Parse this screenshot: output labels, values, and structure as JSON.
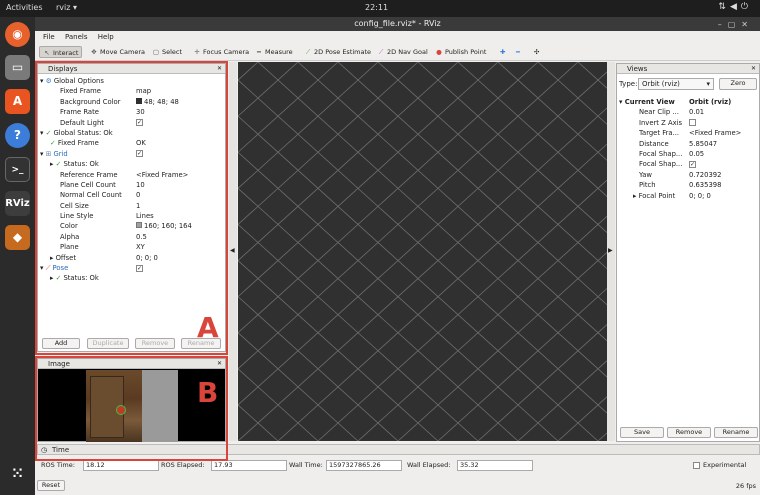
{
  "topbar": {
    "activities": "Activities",
    "app_name": "rviz ▾",
    "clock": "22:11"
  },
  "window": {
    "title": "config_file.rviz* - RViz"
  },
  "menu": [
    "File",
    "Panels",
    "Help"
  ],
  "toolbar": [
    {
      "label": "Interact",
      "icon": "interact-icon",
      "glyph": "↖"
    },
    {
      "label": "Move Camera",
      "icon": "move-camera-icon",
      "glyph": "✥"
    },
    {
      "label": "Select",
      "icon": "select-icon",
      "glyph": "▢"
    },
    {
      "label": "Focus Camera",
      "icon": "focus-icon",
      "glyph": "✛"
    },
    {
      "label": "Measure",
      "icon": "measure-icon",
      "glyph": "━"
    },
    {
      "label": "2D Pose Estimate",
      "icon": "pose-estimate-icon",
      "glyph": "⟋"
    },
    {
      "label": "2D Nav Goal",
      "icon": "nav-goal-icon",
      "glyph": "⟋"
    },
    {
      "label": "Publish Point",
      "icon": "publish-point-icon",
      "glyph": "●"
    }
  ],
  "displays": {
    "title": "Displays",
    "rows": [
      {
        "k": "Global Options",
        "v": ""
      },
      {
        "k": "Fixed Frame",
        "v": "map"
      },
      {
        "k": "Background Color",
        "v": "48; 48; 48"
      },
      {
        "k": "Frame Rate",
        "v": "30"
      },
      {
        "k": "Default Light",
        "v": "✓"
      },
      {
        "k": "Global Status: Ok",
        "v": ""
      },
      {
        "k": "Fixed Frame",
        "v": "OK"
      },
      {
        "k": "Grid",
        "v": "✓"
      },
      {
        "k": "Status: Ok",
        "v": ""
      },
      {
        "k": "Reference Frame",
        "v": "<Fixed Frame>"
      },
      {
        "k": "Plane Cell Count",
        "v": "10"
      },
      {
        "k": "Normal Cell Count",
        "v": "0"
      },
      {
        "k": "Cell Size",
        "v": "1"
      },
      {
        "k": "Line Style",
        "v": "Lines"
      },
      {
        "k": "Color",
        "v": "160; 160; 164"
      },
      {
        "k": "Alpha",
        "v": "0.5"
      },
      {
        "k": "Plane",
        "v": "XY"
      },
      {
        "k": "Offset",
        "v": "0; 0; 0"
      },
      {
        "k": "Pose",
        "v": "✓"
      },
      {
        "k": "Status: Ok",
        "v": ""
      }
    ],
    "buttons": [
      "Add",
      "Duplicate",
      "Remove",
      "Rename"
    ]
  },
  "image_panel": {
    "title": "Image"
  },
  "time_panel": {
    "title": "Time",
    "ros_time_label": "ROS Time:",
    "ros_time": "18.12",
    "ros_elapsed_label": "ROS Elapsed:",
    "ros_elapsed": "17.93",
    "wall_time_label": "Wall Time:",
    "wall_time": "1597327865.26",
    "wall_elapsed_label": "Wall Elapsed:",
    "wall_elapsed": "35.32",
    "experimental": "Experimental",
    "reset": "Reset",
    "fps": "26 fps"
  },
  "views": {
    "title": "Views",
    "type_label": "Type:",
    "type_value": "Orbit (rviz)",
    "zero": "Zero",
    "rows": [
      {
        "k": "Current View",
        "v": "Orbit (rviz)"
      },
      {
        "k": "Near Clip ...",
        "v": "0.01"
      },
      {
        "k": "Invert Z Axis",
        "v": ""
      },
      {
        "k": "Target Fra...",
        "v": "<Fixed Frame>"
      },
      {
        "k": "Distance",
        "v": "5.85047"
      },
      {
        "k": "Focal Shap...",
        "v": "0.05"
      },
      {
        "k": "Focal Shap...",
        "v": "✓"
      },
      {
        "k": "Yaw",
        "v": "0.720392"
      },
      {
        "k": "Pitch",
        "v": "0.635398"
      },
      {
        "k": "Focal Point",
        "v": "0; 0; 0"
      }
    ],
    "buttons": [
      "Save",
      "Remove",
      "Rename"
    ]
  },
  "annotations": {
    "a": "A",
    "b": "B"
  },
  "colors": {
    "annotation": "#d9453a",
    "viewport_bg": "#303030"
  }
}
